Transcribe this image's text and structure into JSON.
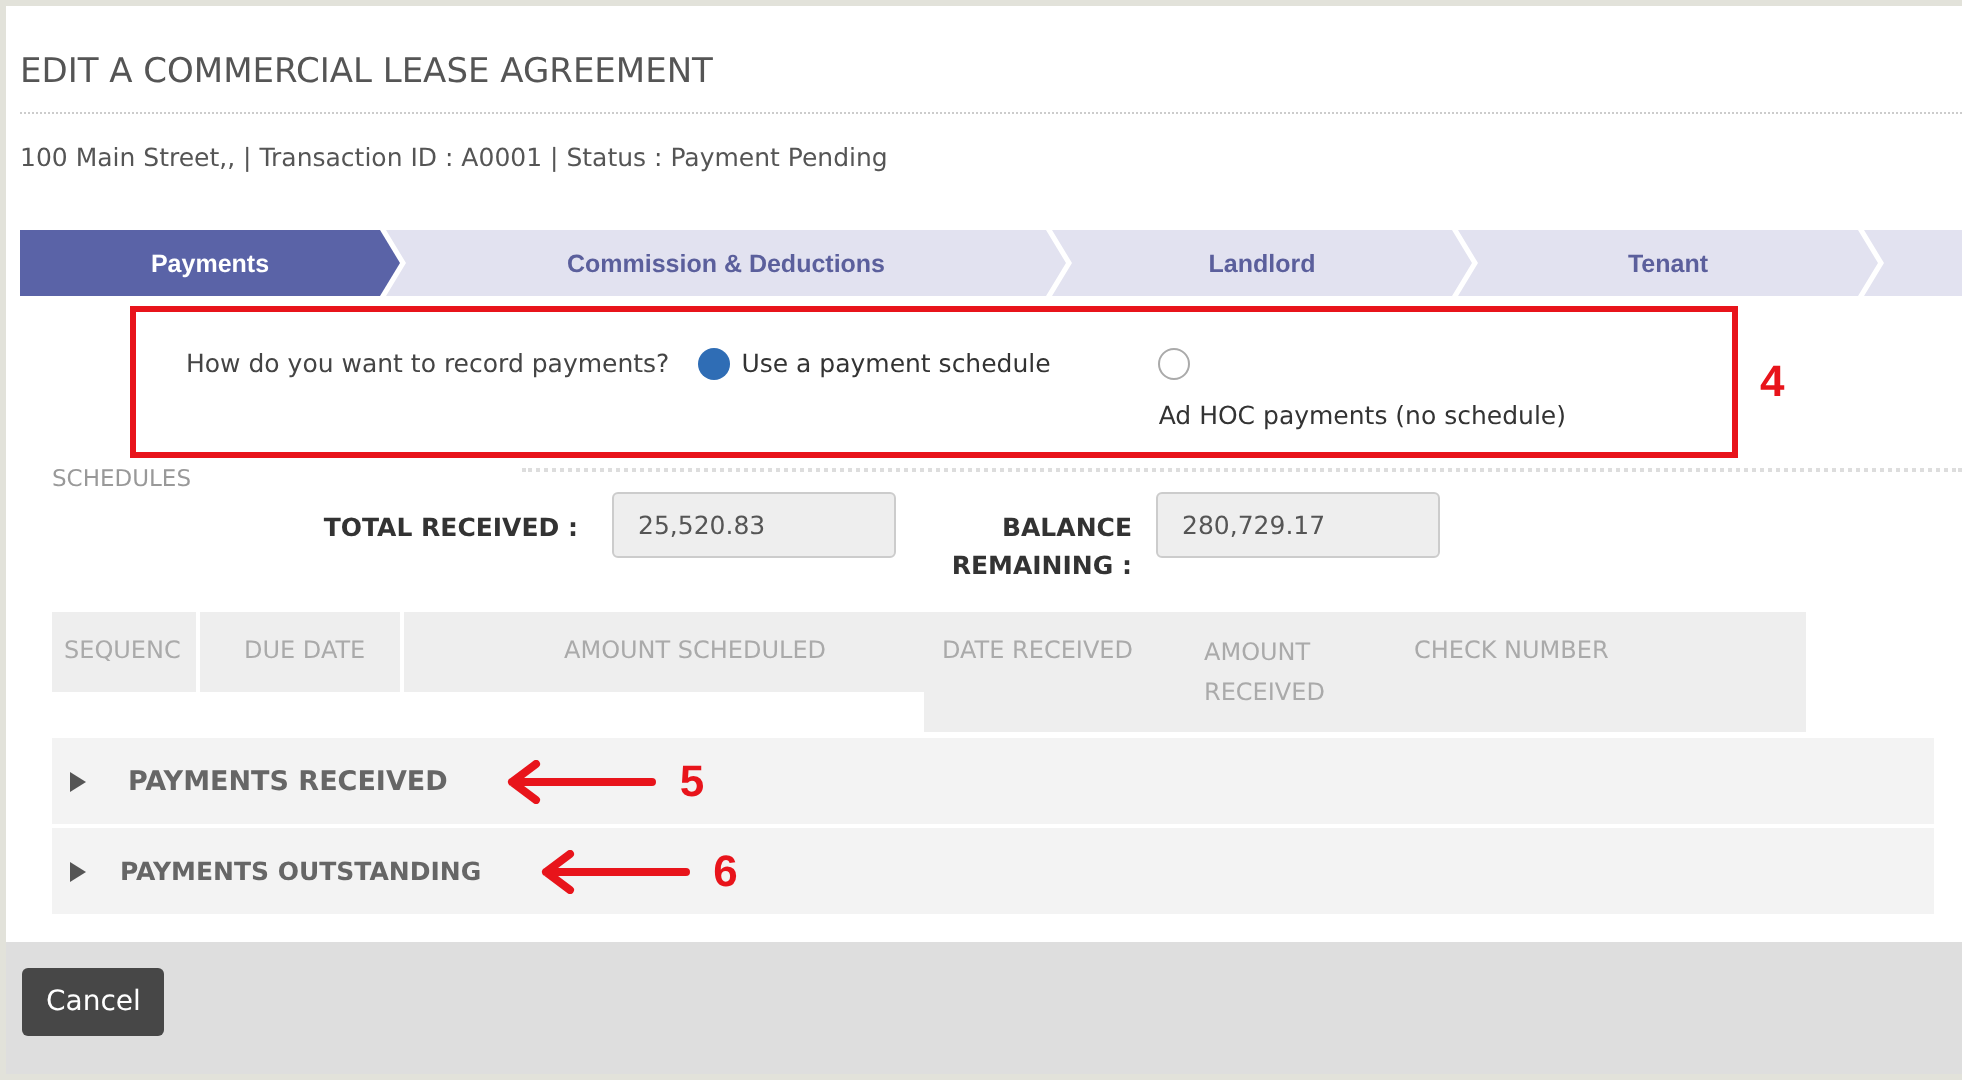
{
  "dialog": {
    "title": "EDIT A COMMERCIAL LEASE AGREEMENT",
    "summary": "100 Main Street,, | Transaction ID : A0001 | Status : Payment Pending"
  },
  "tabs": [
    {
      "label": "Payments",
      "selected": true
    },
    {
      "label": "Commission & Deductions",
      "selected": false
    },
    {
      "label": "Landlord",
      "selected": false
    },
    {
      "label": "Tenant",
      "selected": false
    }
  ],
  "record_method": {
    "question": "How do you want to record payments?",
    "callout": "4",
    "options": [
      {
        "label": "Use a payment schedule",
        "selected": true
      },
      {
        "label": "Ad HOC payments (no schedule)",
        "selected": false
      }
    ]
  },
  "schedules": {
    "heading": "SCHEDULES",
    "total_received": {
      "label": "TOTAL RECEIVED :",
      "value": "25,520.83"
    },
    "balance_remaining": {
      "label": "BALANCE REMAINING :",
      "value": "280,729.17"
    },
    "schedule_columns": [
      "SEQUENC",
      "DUE DATE",
      "AMOUNT SCHEDULED"
    ],
    "receipt_columns": [
      "DATE RECEIVED",
      "AMOUNT RECEIVED",
      "CHECK NUMBER"
    ]
  },
  "sections": [
    {
      "label": "PAYMENTS RECEIVED",
      "expanded": false,
      "callout": "5"
    },
    {
      "label": "PAYMENTS OUTSTANDING",
      "expanded": false,
      "callout": "6"
    }
  ],
  "buttons": [
    "Cancel"
  ]
}
